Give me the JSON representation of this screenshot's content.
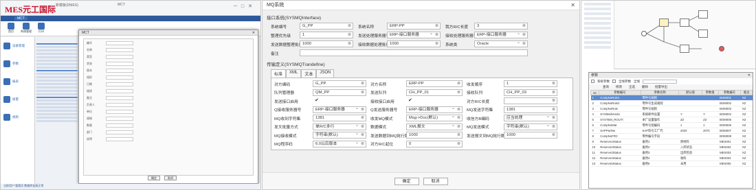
{
  "left_app": {
    "brand": "MES元工国际",
    "window_title": "新模板(DMES)",
    "window_title2": "MCT",
    "tab": "MCT",
    "ribbon_buttons": [
      "首页",
      "系统管理",
      "打印",
      "新增",
      "修改",
      "删除",
      "审核",
      "导出",
      "导入",
      "流程",
      "权限",
      "消息"
    ],
    "nav_items": [
      "设备管理",
      "参数",
      "报表",
      "质量",
      "规则"
    ],
    "dialog_title": "MCT",
    "dialog_fields": [
      "编号",
      "名称",
      "类型",
      "状态",
      "版本",
      "组织",
      "日期",
      "描述",
      "备注",
      "负责人",
      "单位",
      "规格",
      "数量",
      "部门",
      "说明"
    ],
    "ok": "确定",
    "cancel": "取消",
    "status": "当前用户:管理员  数据库连接正常"
  },
  "mq": {
    "title": "MQ系统",
    "section_interface": "接口系统(SYSMQInterface)",
    "row1": {
      "l1": "系统编号",
      "v1": "G_PP",
      "l2": "系统名称",
      "v2": "ERP-PP",
      "l3": "我方R/C长度",
      "v3": "3"
    },
    "row2": {
      "l1": "整理优先级",
      "v1": "1",
      "l2": "发送处理服务器号",
      "v2": "ERP-接口服务器",
      "l3": "接收处理服务器号",
      "v3": "ERP-接口服务器"
    },
    "row3": {
      "l1": "发送数据整理批行数",
      "v1": "1000",
      "l2": "接收数据处理批行数",
      "v2": "1000",
      "l3": "系统类",
      "v3": "Oracle"
    },
    "remark_label": "备注",
    "section_trans": "传输定义(SYSMQTrandefine)",
    "tabs": [
      "标准",
      "XML",
      "文本",
      "JSON"
    ],
    "trans": [
      {
        "l1": "对方编码",
        "v1": "G_PP",
        "l2": "对方名称",
        "v2": "ERP-PP",
        "l3": "收发顺序",
        "v3": "1"
      },
      {
        "l1": "队列管理器",
        "v1": "QM_PP",
        "l2": "发送队列",
        "v2": "CH_PP_01",
        "l3": "接收队列",
        "v3": "CH_PP_03"
      },
      {
        "l1": "发送接口启用",
        "v1": "✔",
        "l2": "接收接口启用",
        "v2": "✔",
        "l3": "对方R/C长度",
        "v3": ""
      },
      {
        "l1": "Q接收服务器号",
        "v1": "ERP-接口服务器",
        "l2": "Q发送服务器号",
        "v2": "ERP-接口服务器",
        "l3": "MQ发送字符集",
        "v3": "1381"
      },
      {
        "l1": "MQ收到字符集",
        "v1": "1381",
        "l2": "收发MQ模式",
        "v2": "Msg->Doc(默认)",
        "l3": "收信方B编码",
        "v3": "应当处理"
      },
      {
        "l1": "发文批量方式",
        "v1": "单R/C多行",
        "l2": "数据模式",
        "v2": "XML报文",
        "l3": "MQ发送模式",
        "v3": "字符串(默认)"
      },
      {
        "l1": "MQ接收模式",
        "v1": "字符串(默认)",
        "l2": "发送数据到MQ批行数",
        "v2": "1000",
        "l3": "发送报文到MQ批行数",
        "v3": "1000"
      },
      {
        "l1": "MQ程序码",
        "v1": "6.0以后版本",
        "l2": "对方R/C起位",
        "v2": "0",
        "l3": "",
        "v3": ""
      }
    ],
    "ok": "确定",
    "cancel": "取消"
  },
  "params": {
    "dialog_title": "参数",
    "filter_labels": [
      "系统参数",
      "全线参数",
      "全线"
    ],
    "toolbar": [
      "查询",
      "修改",
      "全选",
      "删除",
      "批量导出"
    ],
    "headers": [
      "42",
      "参数编号",
      "参数名称",
      "默认值",
      "参数值",
      "参数编号",
      "备注"
    ],
    "rows": [
      [
        "1",
        "CompNoRule1",
        "零件号规则",
        "",
        "",
        "BOM001",
        "XZ"
      ],
      [
        "2",
        "CompNoRule2",
        "零件号生成规则",
        "",
        "",
        "BOM002",
        "XZ"
      ],
      [
        "3",
        "CompNoRule",
        "零件号规则",
        "",
        "",
        "BOM003",
        "XZ"
      ],
      [
        "4",
        "SYSMailVendo",
        "系统邮件设置",
        "Y",
        "Y",
        "BOM004",
        "XZ"
      ],
      [
        "5",
        "SYSTEM_ROUTI",
        "本厂设置操作",
        "ZZ",
        "ZZ",
        "BOM005",
        "XZ"
      ],
      [
        "6",
        "CompNoMat",
        "零件号组编码",
        "1",
        "1",
        "BOM006",
        "XZ"
      ],
      [
        "7",
        "SAPPartNo",
        "SAP料号工厂代",
        "2020",
        "2070",
        "BOM007",
        "XZ"
      ],
      [
        "8",
        "CompNoFRC",
        "零件编号字段",
        "",
        "",
        "BOM008",
        "XZ"
      ],
      [
        "9",
        "Reserve1Status",
        "备用1",
        "原材料",
        "",
        "MES001",
        "XZ"
      ],
      [
        "10",
        "Reserve2Status",
        "备用2",
        "入库状态",
        "",
        "MES002",
        "XZ"
      ],
      [
        "11",
        "Reserve3Status",
        "备用3",
        "出库检验",
        "",
        "MES003",
        "XZ"
      ],
      [
        "12",
        "Reserve4Status",
        "备用4",
        "收料",
        "",
        "MES004",
        "XZ"
      ],
      [
        "13",
        "Reserve5Status",
        "备用5",
        "未用",
        "",
        "MES005",
        "XZ"
      ]
    ]
  }
}
